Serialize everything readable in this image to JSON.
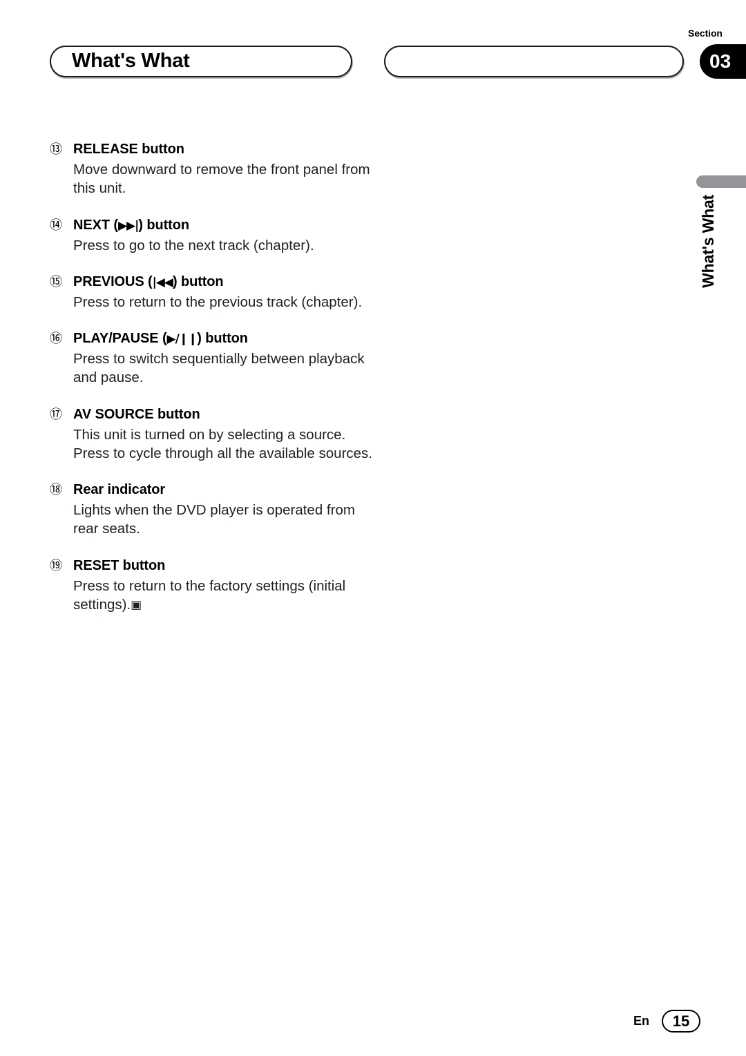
{
  "header": {
    "title": "What's What",
    "secondary_pill_text": "",
    "section_label": "Section",
    "section_number": "03"
  },
  "side_tab": {
    "label": "What's What"
  },
  "entries": [
    {
      "number": "⑬",
      "title": "RELEASE button",
      "glyph": "",
      "suffix": "",
      "body": "Move downward to remove the front panel from this unit."
    },
    {
      "number": "⑭",
      "title": "NEXT (",
      "glyph": "▶▶|",
      "suffix": ") button",
      "body": "Press to go to the next track (chapter)."
    },
    {
      "number": "⑮",
      "title": "PREVIOUS (",
      "glyph": "|◀◀",
      "suffix": ") button",
      "body": "Press to return to the previous track (chapter)."
    },
    {
      "number": "⑯",
      "title": "PLAY/PAUSE (",
      "glyph": "▶/❙❙",
      "suffix": ") button",
      "body": "Press to switch sequentially between playback and pause."
    },
    {
      "number": "⑰",
      "title": "AV SOURCE button",
      "glyph": "",
      "suffix": "",
      "body": "This unit is turned on by selecting a source. Press to cycle through all the available sources."
    },
    {
      "number": "⑱",
      "title": "Rear indicator",
      "glyph": "",
      "suffix": "",
      "body": "Lights when the DVD player is operated from rear seats."
    },
    {
      "number": "⑲",
      "title": "RESET button",
      "glyph": "",
      "suffix": "",
      "body": "Press to return to the factory settings (initial settings).",
      "end_marker": "▣"
    }
  ],
  "footer": {
    "language": "En",
    "page_number": "15"
  },
  "colors": {
    "text": "#000000",
    "body_text": "#231f20",
    "badge_bg": "#000000",
    "side_tab_gray": "#939598"
  }
}
